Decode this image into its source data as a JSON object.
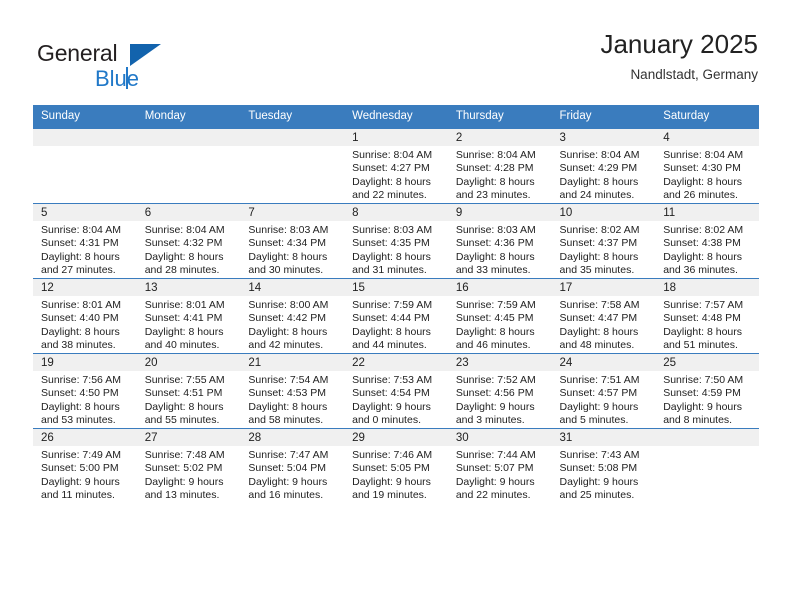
{
  "brand": {
    "name_top": "General",
    "name_bottom": "Blue",
    "accent_color": "#2078c8",
    "triangle_color": "#1263ad"
  },
  "header": {
    "title": "January 2025",
    "subtitle": "Nandlstadt, Germany"
  },
  "theme": {
    "header_row_bg": "#3a7cbe",
    "daynum_band_bg": "#f0f0f0",
    "cell_border": "#3a7cbe",
    "text": "#222222"
  },
  "labels": {
    "sunrise": "Sunrise:",
    "sunset": "Sunset:",
    "daylight": "Daylight:"
  },
  "weekdays": [
    "Sunday",
    "Monday",
    "Tuesday",
    "Wednesday",
    "Thursday",
    "Friday",
    "Saturday"
  ],
  "weeks": [
    [
      {
        "day": "",
        "empty": true
      },
      {
        "day": "",
        "empty": true
      },
      {
        "day": "",
        "empty": true
      },
      {
        "day": "1",
        "sunrise": "Sunrise: 8:04 AM",
        "sunset": "Sunset: 4:27 PM",
        "daylight1": "Daylight: 8 hours",
        "daylight2": "and 22 minutes."
      },
      {
        "day": "2",
        "sunrise": "Sunrise: 8:04 AM",
        "sunset": "Sunset: 4:28 PM",
        "daylight1": "Daylight: 8 hours",
        "daylight2": "and 23 minutes."
      },
      {
        "day": "3",
        "sunrise": "Sunrise: 8:04 AM",
        "sunset": "Sunset: 4:29 PM",
        "daylight1": "Daylight: 8 hours",
        "daylight2": "and 24 minutes."
      },
      {
        "day": "4",
        "sunrise": "Sunrise: 8:04 AM",
        "sunset": "Sunset: 4:30 PM",
        "daylight1": "Daylight: 8 hours",
        "daylight2": "and 26 minutes."
      }
    ],
    [
      {
        "day": "5",
        "sunrise": "Sunrise: 8:04 AM",
        "sunset": "Sunset: 4:31 PM",
        "daylight1": "Daylight: 8 hours",
        "daylight2": "and 27 minutes."
      },
      {
        "day": "6",
        "sunrise": "Sunrise: 8:04 AM",
        "sunset": "Sunset: 4:32 PM",
        "daylight1": "Daylight: 8 hours",
        "daylight2": "and 28 minutes."
      },
      {
        "day": "7",
        "sunrise": "Sunrise: 8:03 AM",
        "sunset": "Sunset: 4:34 PM",
        "daylight1": "Daylight: 8 hours",
        "daylight2": "and 30 minutes."
      },
      {
        "day": "8",
        "sunrise": "Sunrise: 8:03 AM",
        "sunset": "Sunset: 4:35 PM",
        "daylight1": "Daylight: 8 hours",
        "daylight2": "and 31 minutes."
      },
      {
        "day": "9",
        "sunrise": "Sunrise: 8:03 AM",
        "sunset": "Sunset: 4:36 PM",
        "daylight1": "Daylight: 8 hours",
        "daylight2": "and 33 minutes."
      },
      {
        "day": "10",
        "sunrise": "Sunrise: 8:02 AM",
        "sunset": "Sunset: 4:37 PM",
        "daylight1": "Daylight: 8 hours",
        "daylight2": "and 35 minutes."
      },
      {
        "day": "11",
        "sunrise": "Sunrise: 8:02 AM",
        "sunset": "Sunset: 4:38 PM",
        "daylight1": "Daylight: 8 hours",
        "daylight2": "and 36 minutes."
      }
    ],
    [
      {
        "day": "12",
        "sunrise": "Sunrise: 8:01 AM",
        "sunset": "Sunset: 4:40 PM",
        "daylight1": "Daylight: 8 hours",
        "daylight2": "and 38 minutes."
      },
      {
        "day": "13",
        "sunrise": "Sunrise: 8:01 AM",
        "sunset": "Sunset: 4:41 PM",
        "daylight1": "Daylight: 8 hours",
        "daylight2": "and 40 minutes."
      },
      {
        "day": "14",
        "sunrise": "Sunrise: 8:00 AM",
        "sunset": "Sunset: 4:42 PM",
        "daylight1": "Daylight: 8 hours",
        "daylight2": "and 42 minutes."
      },
      {
        "day": "15",
        "sunrise": "Sunrise: 7:59 AM",
        "sunset": "Sunset: 4:44 PM",
        "daylight1": "Daylight: 8 hours",
        "daylight2": "and 44 minutes."
      },
      {
        "day": "16",
        "sunrise": "Sunrise: 7:59 AM",
        "sunset": "Sunset: 4:45 PM",
        "daylight1": "Daylight: 8 hours",
        "daylight2": "and 46 minutes."
      },
      {
        "day": "17",
        "sunrise": "Sunrise: 7:58 AM",
        "sunset": "Sunset: 4:47 PM",
        "daylight1": "Daylight: 8 hours",
        "daylight2": "and 48 minutes."
      },
      {
        "day": "18",
        "sunrise": "Sunrise: 7:57 AM",
        "sunset": "Sunset: 4:48 PM",
        "daylight1": "Daylight: 8 hours",
        "daylight2": "and 51 minutes."
      }
    ],
    [
      {
        "day": "19",
        "sunrise": "Sunrise: 7:56 AM",
        "sunset": "Sunset: 4:50 PM",
        "daylight1": "Daylight: 8 hours",
        "daylight2": "and 53 minutes."
      },
      {
        "day": "20",
        "sunrise": "Sunrise: 7:55 AM",
        "sunset": "Sunset: 4:51 PM",
        "daylight1": "Daylight: 8 hours",
        "daylight2": "and 55 minutes."
      },
      {
        "day": "21",
        "sunrise": "Sunrise: 7:54 AM",
        "sunset": "Sunset: 4:53 PM",
        "daylight1": "Daylight: 8 hours",
        "daylight2": "and 58 minutes."
      },
      {
        "day": "22",
        "sunrise": "Sunrise: 7:53 AM",
        "sunset": "Sunset: 4:54 PM",
        "daylight1": "Daylight: 9 hours",
        "daylight2": "and 0 minutes."
      },
      {
        "day": "23",
        "sunrise": "Sunrise: 7:52 AM",
        "sunset": "Sunset: 4:56 PM",
        "daylight1": "Daylight: 9 hours",
        "daylight2": "and 3 minutes."
      },
      {
        "day": "24",
        "sunrise": "Sunrise: 7:51 AM",
        "sunset": "Sunset: 4:57 PM",
        "daylight1": "Daylight: 9 hours",
        "daylight2": "and 5 minutes."
      },
      {
        "day": "25",
        "sunrise": "Sunrise: 7:50 AM",
        "sunset": "Sunset: 4:59 PM",
        "daylight1": "Daylight: 9 hours",
        "daylight2": "and 8 minutes."
      }
    ],
    [
      {
        "day": "26",
        "sunrise": "Sunrise: 7:49 AM",
        "sunset": "Sunset: 5:00 PM",
        "daylight1": "Daylight: 9 hours",
        "daylight2": "and 11 minutes."
      },
      {
        "day": "27",
        "sunrise": "Sunrise: 7:48 AM",
        "sunset": "Sunset: 5:02 PM",
        "daylight1": "Daylight: 9 hours",
        "daylight2": "and 13 minutes."
      },
      {
        "day": "28",
        "sunrise": "Sunrise: 7:47 AM",
        "sunset": "Sunset: 5:04 PM",
        "daylight1": "Daylight: 9 hours",
        "daylight2": "and 16 minutes."
      },
      {
        "day": "29",
        "sunrise": "Sunrise: 7:46 AM",
        "sunset": "Sunset: 5:05 PM",
        "daylight1": "Daylight: 9 hours",
        "daylight2": "and 19 minutes."
      },
      {
        "day": "30",
        "sunrise": "Sunrise: 7:44 AM",
        "sunset": "Sunset: 5:07 PM",
        "daylight1": "Daylight: 9 hours",
        "daylight2": "and 22 minutes."
      },
      {
        "day": "31",
        "sunrise": "Sunrise: 7:43 AM",
        "sunset": "Sunset: 5:08 PM",
        "daylight1": "Daylight: 9 hours",
        "daylight2": "and 25 minutes."
      },
      {
        "day": "",
        "empty": true
      }
    ]
  ]
}
